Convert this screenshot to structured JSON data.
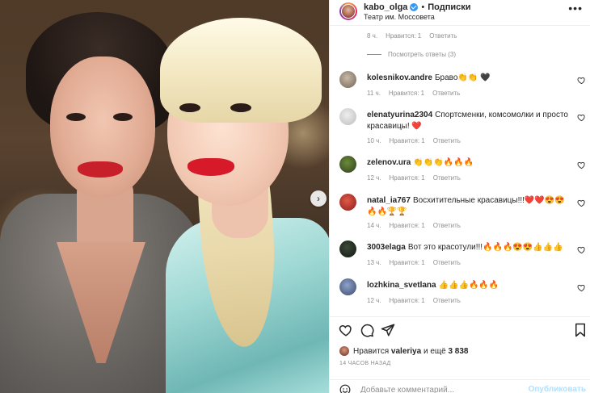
{
  "post": {
    "username": "kabo_olga",
    "follow_label": "Подписки",
    "location": "Театр им. Моссовета",
    "more_label": "•••"
  },
  "previous_comment_meta": {
    "time": "8 ч.",
    "likes": "Нравится: 1",
    "reply": "Ответить"
  },
  "view_replies": "Посмотреть ответы (3)",
  "comments": [
    {
      "user": "kolesnikov.andre",
      "text": "Браво👏👏 🖤",
      "time": "11 ч.",
      "likes": "Нравится: 1",
      "reply": "Ответить"
    },
    {
      "user": "elenatyurina2304",
      "text": "Спортсменки, комсомолки и просто красавицы! ❤️",
      "time": "10 ч.",
      "likes": "Нравится: 1",
      "reply": "Ответить"
    },
    {
      "user": "zelenov.ura",
      "text": "👏👏👏🔥🔥🔥",
      "time": "12 ч.",
      "likes": "Нравится: 1",
      "reply": "Ответить"
    },
    {
      "user": "natal_ia767",
      "text": "Восхитительные красавицы!!!❤️❤️😍😍🔥🔥🏆🏆",
      "time": "14 ч.",
      "likes": "Нравится: 1",
      "reply": "Ответить"
    },
    {
      "user": "3003elaga",
      "text": "Вот это красотули!!!🔥🔥🔥😍😍👍👍👍",
      "time": "13 ч.",
      "likes": "Нравится: 1",
      "reply": "Ответить"
    },
    {
      "user": "lozhkina_svetlana",
      "text": "👍👍👍🔥🔥🔥",
      "time": "12 ч.",
      "likes": "Нравится: 1",
      "reply": "Ответить"
    }
  ],
  "likes_line": {
    "prefix": "Нравится",
    "user": "valeriya",
    "middle": "и ещё",
    "count": "3 838"
  },
  "time_ago": "14 ЧАСОВ НАЗАД",
  "add_comment": {
    "placeholder": "Добавьте комментарий...",
    "publish_label": "Опубликовать"
  },
  "colors": {
    "link_blue": "#3897f0",
    "publish_disabled": "#b2dffc",
    "meta_gray": "#8e8e8e",
    "text": "#262626"
  },
  "icons": {
    "like": "heart-outline-icon",
    "comment": "speech-bubble-icon",
    "share": "paper-plane-icon",
    "save": "bookmark-icon",
    "emoji": "smile-icon",
    "next": "chevron-right-icon"
  }
}
